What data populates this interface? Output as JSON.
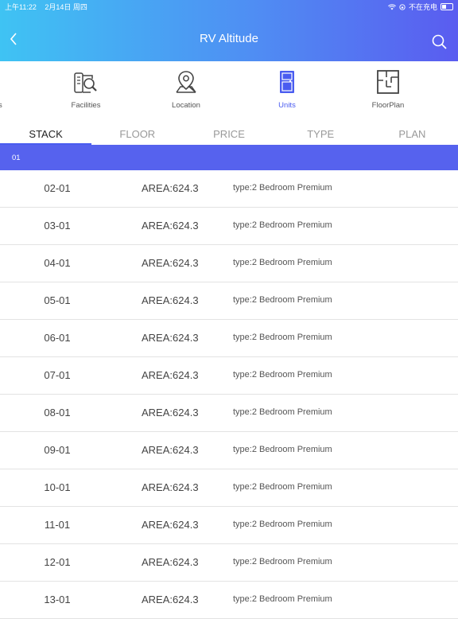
{
  "status": {
    "time": "上午11:22",
    "date": "2月14日 周四",
    "charging": "不在充电"
  },
  "header": {
    "title": "RV Altitude"
  },
  "nav": {
    "partial_label": "s",
    "items": [
      {
        "label": "Facilities",
        "icon": "facilities-icon"
      },
      {
        "label": "Location",
        "icon": "location-pin-icon"
      },
      {
        "label": "Units",
        "icon": "door-icon"
      },
      {
        "label": "FloorPlan",
        "icon": "floorplan-icon"
      }
    ],
    "active": "Units",
    "accent": "#4a5cf0"
  },
  "tabs": [
    {
      "label": "STACK",
      "active": true
    },
    {
      "label": "FLOOR",
      "active": false
    },
    {
      "label": "PRICE",
      "active": false
    },
    {
      "label": "TYPE",
      "active": false
    },
    {
      "label": "PLAN",
      "active": false
    }
  ],
  "section": {
    "label": "01"
  },
  "units": [
    {
      "unit": "02-01",
      "area": "AREA:624.3",
      "type": "type:2 Bedroom Premium"
    },
    {
      "unit": "03-01",
      "area": "AREA:624.3",
      "type": "type:2 Bedroom Premium"
    },
    {
      "unit": "04-01",
      "area": "AREA:624.3",
      "type": "type:2 Bedroom Premium"
    },
    {
      "unit": "05-01",
      "area": "AREA:624.3",
      "type": "type:2 Bedroom Premium"
    },
    {
      "unit": "06-01",
      "area": "AREA:624.3",
      "type": "type:2 Bedroom Premium"
    },
    {
      "unit": "07-01",
      "area": "AREA:624.3",
      "type": "type:2 Bedroom Premium"
    },
    {
      "unit": "08-01",
      "area": "AREA:624.3",
      "type": "type:2 Bedroom Premium"
    },
    {
      "unit": "09-01",
      "area": "AREA:624.3",
      "type": "type:2 Bedroom Premium"
    },
    {
      "unit": "10-01",
      "area": "AREA:624.3",
      "type": "type:2 Bedroom Premium"
    },
    {
      "unit": "11-01",
      "area": "AREA:624.3",
      "type": "type:2 Bedroom Premium"
    },
    {
      "unit": "12-01",
      "area": "AREA:624.3",
      "type": "type:2 Bedroom Premium"
    },
    {
      "unit": "13-01",
      "area": "AREA:624.3",
      "type": "type:2 Bedroom Premium"
    }
  ]
}
